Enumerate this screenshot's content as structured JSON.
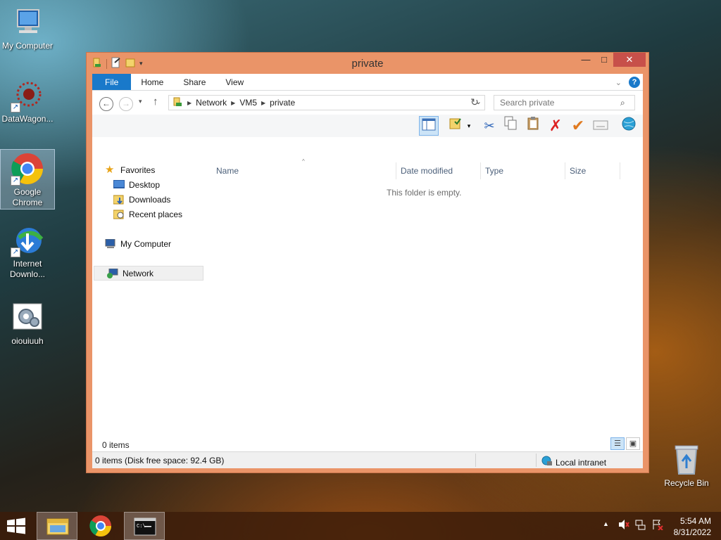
{
  "desktop": {
    "icons": [
      {
        "label": "My Computer"
      },
      {
        "label": "DataWagon..."
      },
      {
        "label": "Google Chrome"
      },
      {
        "label": "Internet Downlo..."
      },
      {
        "label": "oiouiuuh"
      },
      {
        "label": "Recycle Bin"
      }
    ]
  },
  "window": {
    "title": "private",
    "ribbon_tabs": [
      "File",
      "Home",
      "Share",
      "View"
    ],
    "address": {
      "segments": [
        "Network",
        "VM5",
        "private"
      ]
    },
    "search_placeholder": "Search private",
    "nav": {
      "favorites": "Favorites",
      "items": [
        "Desktop",
        "Downloads",
        "Recent places"
      ],
      "my_computer": "My Computer",
      "network": "Network"
    },
    "columns": [
      "Name",
      "Date modified",
      "Type",
      "Size"
    ],
    "empty_message": "This folder is empty.",
    "items_count": "0 items",
    "status": {
      "left": "0 items (Disk free space: 92.4 GB)",
      "zone": "Local intranet"
    }
  },
  "taskbar": {
    "clock_time": "5:54 AM",
    "clock_date": "8/31/2022"
  },
  "colors": {
    "title_accent": "#ea9468",
    "file_tab": "#1979ca",
    "close_button": "#c7504a"
  }
}
